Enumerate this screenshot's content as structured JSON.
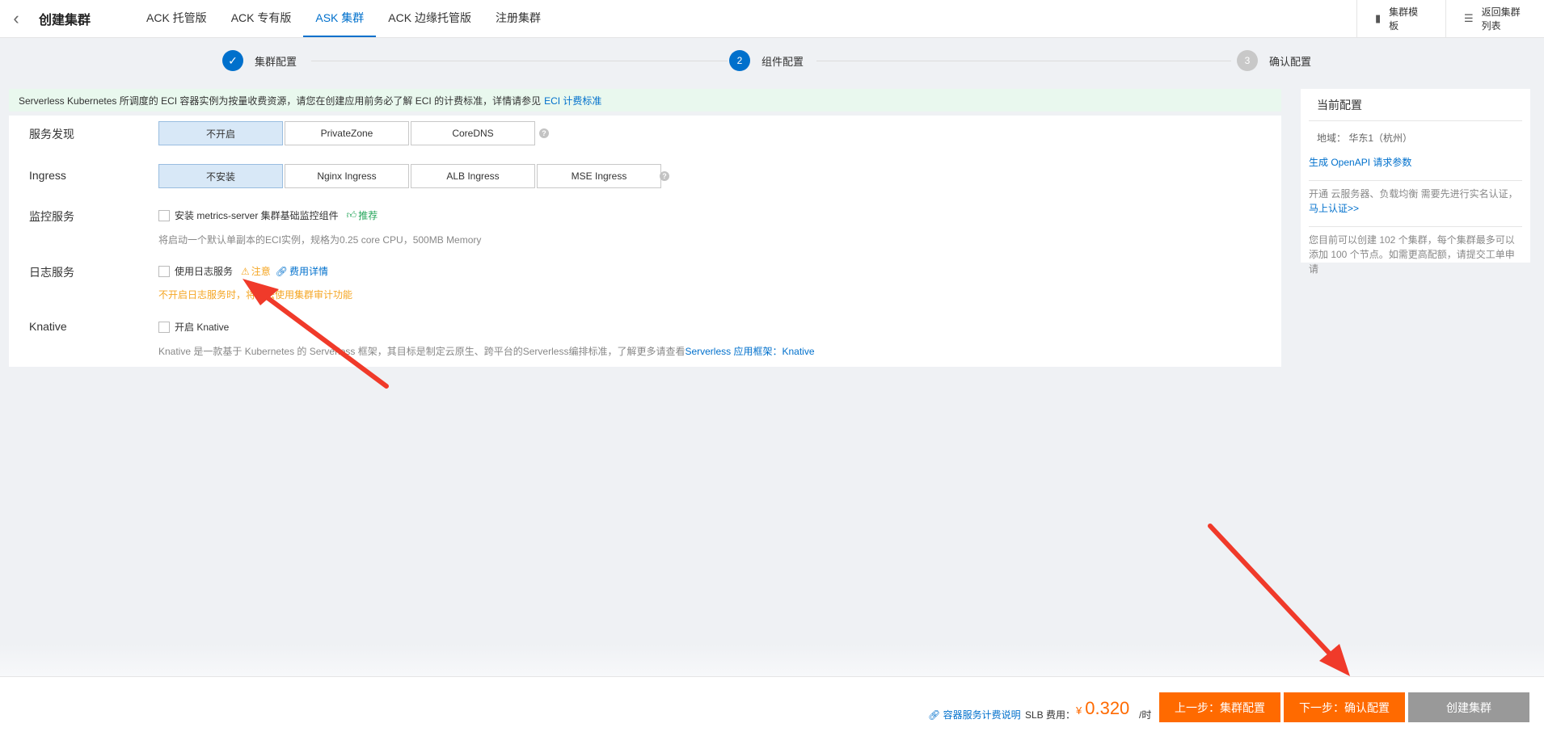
{
  "header": {
    "back_icon": "chevron-left-icon",
    "title": "创建集群",
    "tabs": [
      {
        "label": "ACK 托管版"
      },
      {
        "label": "ACK 专有版"
      },
      {
        "label": "ASK 集群"
      },
      {
        "label": "ACK 边缘托管版"
      },
      {
        "label": "注册集群"
      }
    ],
    "active_tab": "ASK 集群",
    "template_button": "集群模板",
    "back_list_button": "返回集群列表"
  },
  "steps": [
    {
      "label": "集群配置",
      "status": "done",
      "marker": "✓"
    },
    {
      "label": "组件配置",
      "status": "current",
      "marker": "2"
    },
    {
      "label": "确认配置",
      "status": "todo",
      "marker": "3"
    }
  ],
  "notice": {
    "text": "Serverless Kubernetes 所调度的 ECI 容器实例为按量收费资源，请您在创建应用前务必了解 ECI 的计费标准，详情请参见",
    "link": "ECI 计费标准"
  },
  "form": {
    "service_discovery": {
      "label": "服务发现",
      "options": [
        "不开启",
        "PrivateZone",
        "CoreDNS"
      ],
      "selected": "不开启"
    },
    "ingress": {
      "label": "Ingress",
      "options": [
        "不安装",
        "Nginx Ingress",
        "ALB Ingress",
        "MSE Ingress"
      ],
      "selected": "不安装"
    },
    "monitoring": {
      "label": "监控服务",
      "checkbox_label": "安装 metrics-server 集群基础监控组件",
      "recommend": "推荐",
      "desc": "将启动一个默认单副本的ECI实例，规格为0.25 core CPU，500MB Memory"
    },
    "logging": {
      "label": "日志服务",
      "checkbox_label": "使用日志服务",
      "warn": "注意",
      "fee_link": "费用详情",
      "desc": "不开启日志服务时，将无法使用集群审计功能"
    },
    "knative": {
      "label": "Knative",
      "checkbox_label": "开启 Knative",
      "desc": "Knative 是一款基于 Kubernetes 的 Serverless 框架，其目标是制定云原生、跨平台的Serverless编排标准，了解更多请查看",
      "desc_link": "Serverless 应用框架：Knative"
    }
  },
  "sidebar": {
    "title": "当前配置",
    "region": "地域：  华东1（杭州）",
    "openapi_link": "生成 OpenAPI 请求参数",
    "auth_text": "开通 云服务器、负载均衡 需要先进行实名认证，",
    "auth_link": "马上认证>>",
    "quota_text": "您目前可以创建 102 个集群，每个集群最多可以添加 100 个节点。如需更高配额，请提交工单申请"
  },
  "footer": {
    "fee_link": "容器服务计费说明",
    "slb_label": "SLB 费用：",
    "currency": "¥",
    "price": "0.320",
    "unit": "/时",
    "prev_button": "上一步：集群配置",
    "next_button": "下一步：确认配置",
    "create_button": "创建集群"
  },
  "colors": {
    "primary": "#0070cc",
    "orange": "#ff6a00",
    "annotation_arrow": "#f03a2a"
  }
}
